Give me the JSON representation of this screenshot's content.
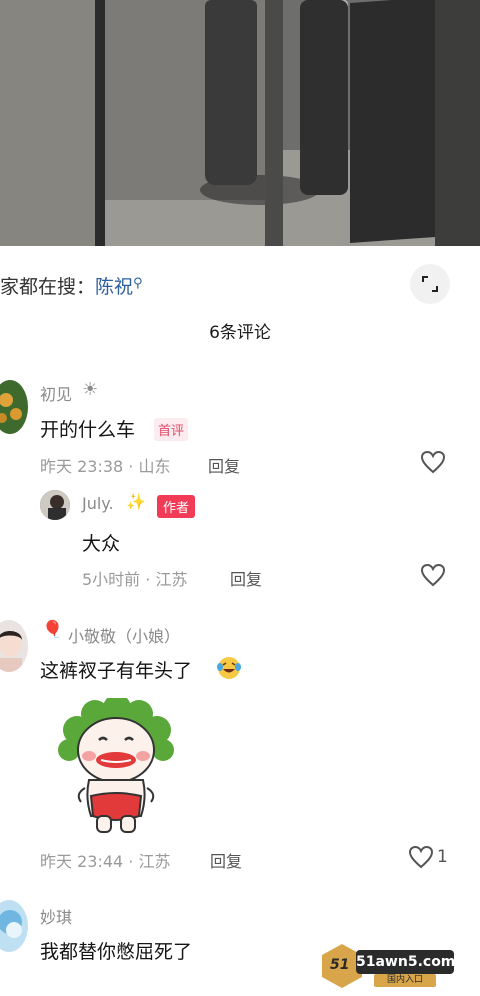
{
  "search": {
    "prefix": "家都在搜：",
    "keyword": "陈祝",
    "icon": "search-icon"
  },
  "comments_header": {
    "title": "6条评论"
  },
  "comments": [
    {
      "user": "初见",
      "badge_icon": "sun-icon",
      "text": "开的什么车",
      "tag": "首评",
      "time_location": "昨天 23:38 · 山东",
      "reply_label": "回复",
      "replies": [
        {
          "user": "July.",
          "badge_icon": "sparkle-icon",
          "tag": "作者",
          "text": "大众",
          "time_location": "5小时前 · 江苏",
          "reply_label": "回复"
        }
      ]
    },
    {
      "user": "小敬敬（小娘）",
      "badge_icon": "balloon-icon",
      "text": "这裤衩子有年头了",
      "emoji": "laughing-crying-icon",
      "sticker": "clown-sticker",
      "time_location": "昨天 23:44 · 江苏",
      "reply_label": "回复",
      "likes": "1"
    },
    {
      "user": "妙琪",
      "text": "我都替你憋屈死了"
    }
  ],
  "watermark": {
    "badge": "51",
    "main": "51awn5.com",
    "sub": "国内入口"
  },
  "colors": {
    "accent": "#f23c57",
    "link": "#2f5f9f"
  }
}
